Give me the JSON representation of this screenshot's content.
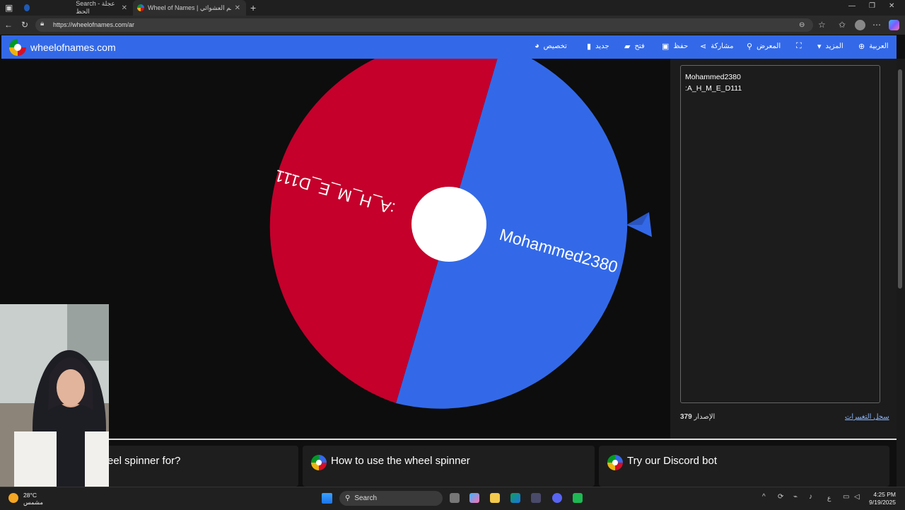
{
  "browser": {
    "tabs": [
      {
        "title": "Search - عجلة الحظ",
        "active": false
      },
      {
        "title": "Wheel of Names | الاسم العشوائي",
        "active": true
      }
    ],
    "url": "https://wheelofnames.com/ar"
  },
  "navbar": {
    "brand": "wheelofnames.com",
    "items": [
      "تخصيص",
      "جديد",
      "فتح",
      "حفظ",
      "مشاركة",
      "المعرض",
      "المزيد",
      "العربية"
    ]
  },
  "wheel": {
    "segments": [
      {
        "label": "Mohammed2380",
        "color": "#3369e8"
      },
      {
        "label": ":A_H_M_E_D111",
        "color": "#c4002b"
      }
    ]
  },
  "entries": {
    "lines": [
      "Mohammed2380",
      ":A_H_M_E_D111"
    ],
    "version_label": "الإصدار",
    "version_number": "379",
    "changelog_link": "سجل التغييرات"
  },
  "cards": [
    {
      "title": "eel spinner for?"
    },
    {
      "title": "How to use the wheel spinner"
    },
    {
      "title": "Try our Discord bot"
    }
  ],
  "taskbar": {
    "weather_temp": "28°C",
    "weather_desc": "مشمس",
    "search_placeholder": "Search",
    "time": "4:25 PM",
    "date": "9/19/2025"
  }
}
